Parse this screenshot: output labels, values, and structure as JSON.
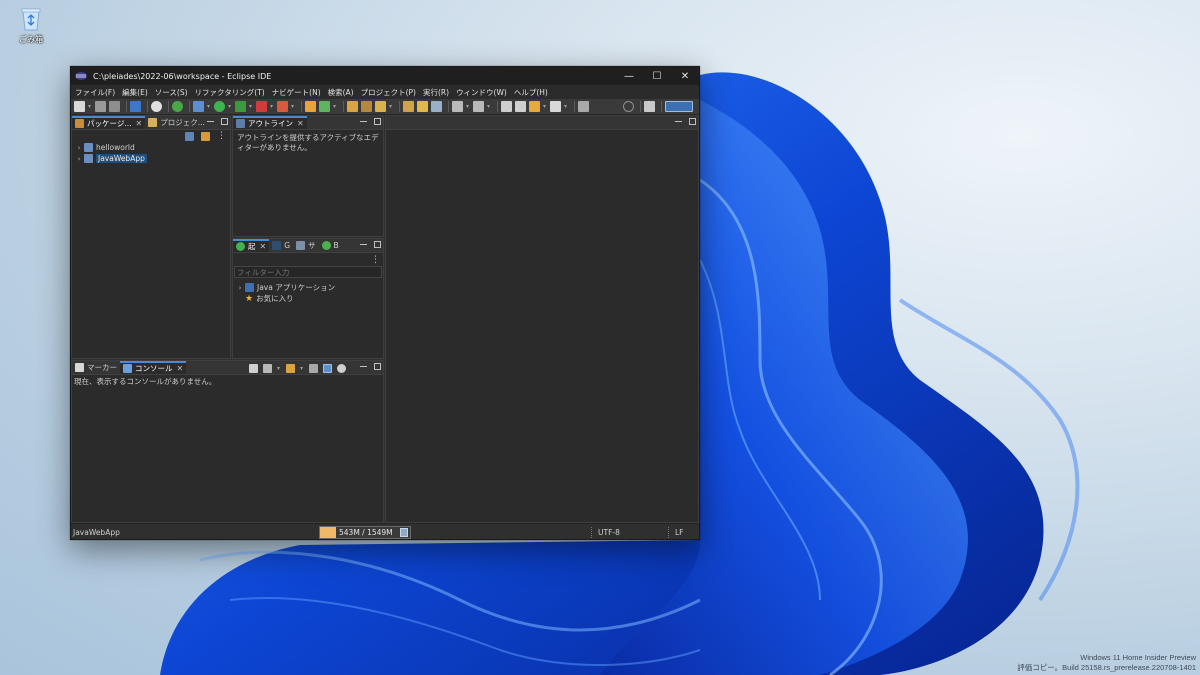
{
  "desktop": {
    "recycle_bin_label": "ごみ箱",
    "watermark_line1": "Windows 11 Home Insider Preview",
    "watermark_line2": "評価コピー。Build 25158.rs_prerelease.220708-1401"
  },
  "window": {
    "title": "C:\\pleiades\\2022-06\\workspace - Eclipse IDE",
    "controls": {
      "minimize": "—",
      "maximize": "☐",
      "close": "✕"
    }
  },
  "menu": [
    "ファイル(F)",
    "編集(E)",
    "ソース(S)",
    "リファクタリング(T)",
    "ナビゲート(N)",
    "検索(A)",
    "プロジェクト(P)",
    "実行(R)",
    "ウィンドウ(W)",
    "ヘルプ(H)"
  ],
  "package_explorer": {
    "tab_active": "パッケージ...",
    "tab_other": "プロジェク...",
    "items": [
      {
        "label": "helloworld",
        "selected": false
      },
      {
        "label": "JavaWebApp",
        "selected": true
      }
    ]
  },
  "outline": {
    "tab": "アウトライン",
    "message": "アウトラインを提供するアクティブなエディターがありません。"
  },
  "launch_panel": {
    "tab_active": "起",
    "tab_g": "G",
    "tab_s": "サ",
    "tab_b": "B",
    "filter_placeholder": "フィルター入力",
    "items": [
      {
        "label": "Java アプリケーション",
        "icon": "java-app-icon"
      },
      {
        "label": "お気に入り",
        "icon": "star-icon"
      }
    ]
  },
  "console": {
    "tab_markers": "マーカー",
    "tab_console": "コンソール",
    "message": "現在、表示するコンソールがありません。"
  },
  "statusbar": {
    "selection": "JavaWebApp",
    "heap": "543M / 1549M",
    "heap_fraction": 0.35,
    "encoding": "UTF-8",
    "line_delimiter": "LF"
  },
  "colors": {
    "accent": "#4a8ad4",
    "selection": "#1f4f7f",
    "heap_fill": "#f0b968",
    "wallpaper_blue": "#1247d6"
  }
}
